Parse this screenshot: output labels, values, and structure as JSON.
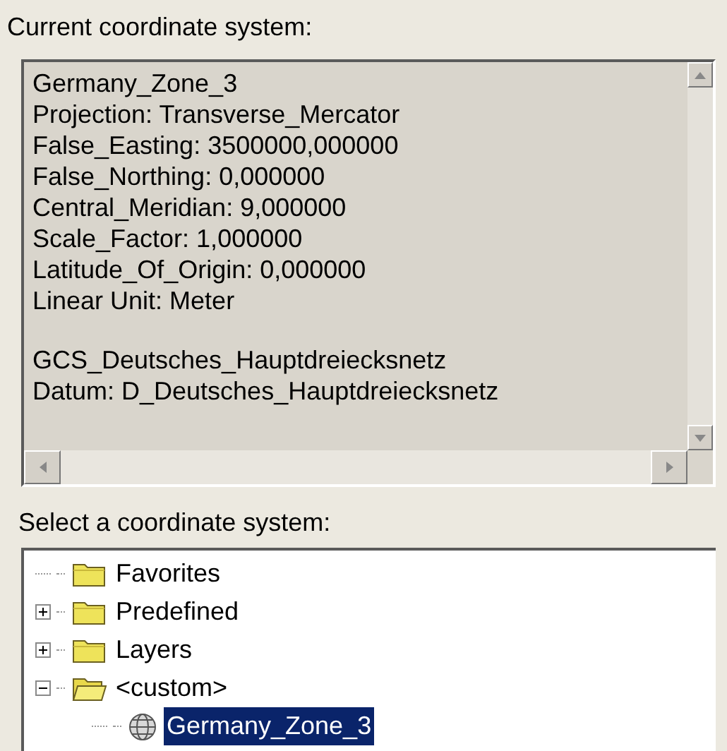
{
  "current_label": "Current coordinate system:",
  "details": {
    "paragraphs": [
      [
        "Germany_Zone_3",
        "Projection: Transverse_Mercator",
        "False_Easting: 3500000,000000",
        "False_Northing: 0,000000",
        "Central_Meridian: 9,000000",
        "Scale_Factor: 1,000000",
        "Latitude_Of_Origin: 0,000000",
        "Linear Unit: Meter"
      ],
      [
        "GCS_Deutsches_Hauptdreiecksnetz",
        "Datum: D_Deutsches_Hauptdreiecksnetz"
      ]
    ]
  },
  "select_label": "Select a coordinate system:",
  "tree": [
    {
      "label": "Favorites",
      "kind": "folder",
      "expandable": false,
      "expanded": false,
      "selected": false
    },
    {
      "label": "Predefined",
      "kind": "folder",
      "expandable": true,
      "expanded": false,
      "selected": false
    },
    {
      "label": "Layers",
      "kind": "folder",
      "expandable": true,
      "expanded": false,
      "selected": false
    },
    {
      "label": "<custom>",
      "kind": "folder",
      "expandable": true,
      "expanded": true,
      "selected": false,
      "children": [
        {
          "label": "Germany_Zone_3",
          "kind": "system",
          "expandable": false,
          "expanded": false,
          "selected": true
        }
      ]
    }
  ]
}
